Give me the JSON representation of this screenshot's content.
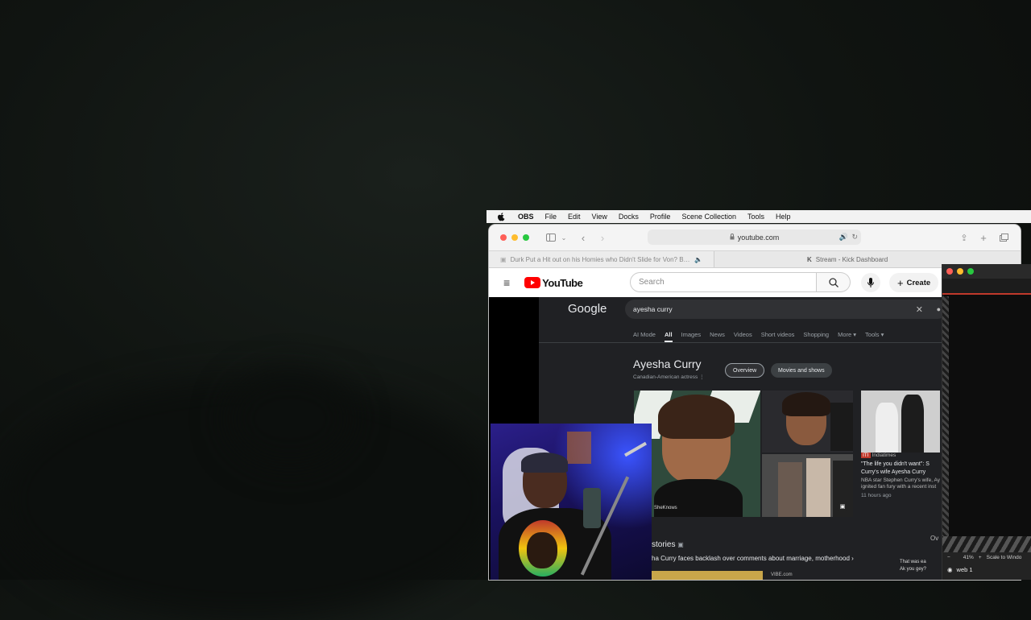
{
  "menubar": {
    "app": "OBS",
    "items": [
      "File",
      "Edit",
      "View",
      "Docks",
      "Profile",
      "Scene Collection",
      "Tools",
      "Help"
    ]
  },
  "safari": {
    "url": "youtube.com",
    "tabs": [
      {
        "label": "Durk Put a Hit out on his Homies who Didn't Slide for Von? Bia vs Cardi B? Lil Tjay..."
      },
      {
        "label": "Stream - Kick Dashboard"
      }
    ]
  },
  "youtube": {
    "logo": "YouTube",
    "search_placeholder": "Search",
    "create_label": "Create"
  },
  "google": {
    "logo": "Google",
    "query": "ayesha curry",
    "nav": [
      "AI Mode",
      "All",
      "Images",
      "News",
      "Videos",
      "Short videos",
      "Shopping",
      "More ▾",
      "Tools ▾"
    ],
    "kp_title": "Ayesha Curry",
    "kp_subtitle": "Canadian-American actress",
    "chip_overview": "Overview",
    "chip_movies": "Movies and shows",
    "img_credit": "SheKnows",
    "news_source": "Indiatimes",
    "news_headline": "\"The life you didn't want\": S Curry's wife Ayesha Curry",
    "news_body": "NBA star Stephen Curry's wife, Ay ignited fan fury with a recent inst",
    "news_time": "11 hours ago",
    "stories_label": "stories",
    "story_line": "ha Curry faces backlash over comments about marriage, motherhood",
    "story_source": "VIBE.com",
    "right_snip": "Ov",
    "chat1": "That was ea",
    "chat2": "Ak you gey?"
  },
  "obs": {
    "zoom": "41%",
    "scale_label": "Scale to Windo",
    "source": "web 1"
  }
}
